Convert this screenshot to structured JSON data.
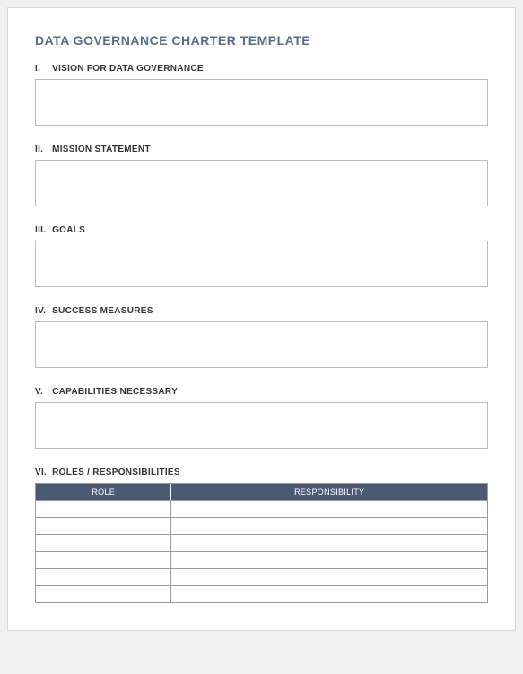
{
  "title": "DATA GOVERNANCE CHARTER TEMPLATE",
  "sections": [
    {
      "numeral": "I.",
      "label": "VISION FOR DATA GOVERNANCE",
      "value": ""
    },
    {
      "numeral": "II.",
      "label": "MISSION STATEMENT",
      "value": ""
    },
    {
      "numeral": "III.",
      "label": "GOALS",
      "value": ""
    },
    {
      "numeral": "IV.",
      "label": "SUCCESS MEASURES",
      "value": ""
    },
    {
      "numeral": "V.",
      "label": "CAPABILITIES NECESSARY",
      "value": ""
    }
  ],
  "table_section": {
    "numeral": "VI.",
    "label": "ROLES / RESPONSIBILITIES",
    "columns": [
      "ROLE",
      "RESPONSIBILITY"
    ],
    "rows": [
      {
        "role": "",
        "responsibility": ""
      },
      {
        "role": "",
        "responsibility": ""
      },
      {
        "role": "",
        "responsibility": ""
      },
      {
        "role": "",
        "responsibility": ""
      },
      {
        "role": "",
        "responsibility": ""
      },
      {
        "role": "",
        "responsibility": ""
      }
    ]
  }
}
